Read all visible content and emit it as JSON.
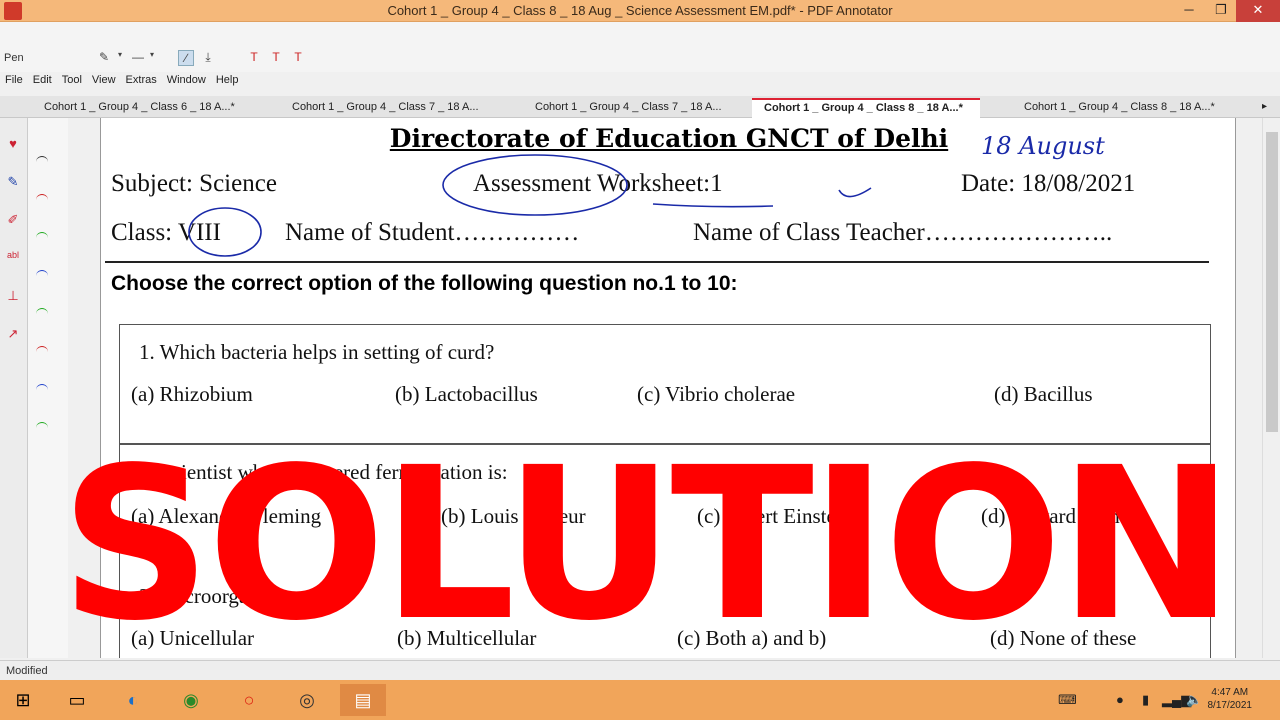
{
  "window": {
    "title": "Cohort 1 _ Group 4 _ Class 8 _ 18 Aug _ Science Assessment EM.pdf* - PDF Annotator",
    "minimize": "─",
    "restore": "❐",
    "close": "✕"
  },
  "toolbar": {
    "tool_label": "Pen"
  },
  "menu": [
    "File",
    "Edit",
    "Tool",
    "View",
    "Extras",
    "Window",
    "Help"
  ],
  "tabs": [
    {
      "label": "Cohort 1 _ Group 4 _ Class 6 _ 18 A...*"
    },
    {
      "label": "Cohort 1 _ Group 4 _ Class 7 _ 18 A..."
    },
    {
      "label": "Cohort 1 _ Group 4 _ Class 7 _ 18 A..."
    },
    {
      "label": "Cohort 1 _ Group 4 _ Class 8 _ 18 A...*",
      "active": true
    },
    {
      "label": "Cohort 1 _ Group 4 _ Class 8 _ 18 A...*"
    }
  ],
  "document": {
    "heading": "Directorate of Education GNCT of Delhi",
    "subject": "Subject: Science",
    "worksheet": "Assessment Worksheet:1",
    "date": "Date: 18/08/2021",
    "class": "Class: VIII",
    "student": "Name of Student……………",
    "teacher": "Name of Class Teacher…………………..",
    "instruction": "Choose the correct option of  the following question no.1 to 10:",
    "handwritten_note": "18 August",
    "questions": [
      {
        "text": "1.  Which bacteria helps in setting of curd?",
        "options": [
          "(a) Rhizobium",
          "(b) Lactobacillus",
          "(c) Vibrio cholerae",
          "(d) Bacillus"
        ]
      },
      {
        "text": "2.  Scientist who discovered fermentation is:",
        "options": [
          "(a)  Alexander Fleming",
          "(b) Louis Pasteur",
          "(c) Albert Einstein",
          "(d) Edward Jenner"
        ]
      },
      {
        "text": "3.  Microorganisms are:",
        "options": [
          "(a)  Unicellular",
          "(b) Multicellular",
          "(c) Both a) and b)",
          "(d) None of these"
        ]
      }
    ]
  },
  "overlay_text": "SOLUTION",
  "statusbar": {
    "text": "Modified"
  },
  "taskbar": {
    "time": "4:47 AM",
    "date": "8/17/2021"
  },
  "colors": {
    "overlay": "#ff0000",
    "ink": "#1a2aa8",
    "titlebar": "#f5b87a",
    "taskbar": "#f1a55a"
  }
}
